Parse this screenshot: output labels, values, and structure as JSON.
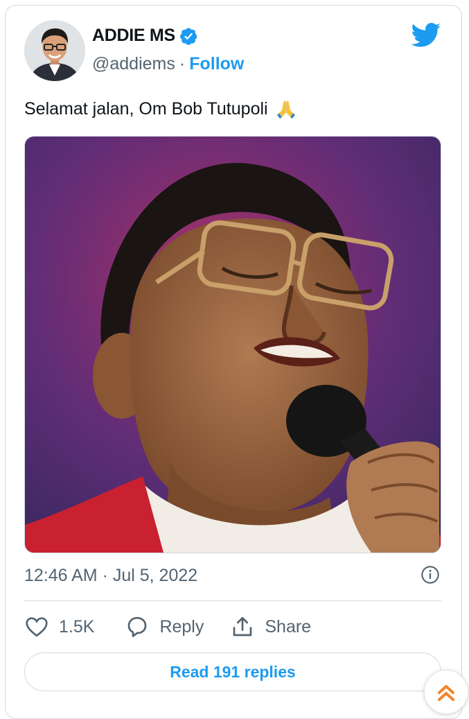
{
  "author": {
    "display_name": "ADDIE MS",
    "handle": "@addiems",
    "separator": "·",
    "follow_label": "Follow"
  },
  "tweet": {
    "text": "Selamat jalan, Om Bob Tutupoli",
    "emoji": "folded-hands-emoji",
    "timestamp": "12:46 AM · Jul 5, 2022"
  },
  "actions": {
    "like_count": "1.5K",
    "reply_label": "Reply",
    "share_label": "Share"
  },
  "read_replies_label": "Read 191 replies",
  "icons": {
    "verified": "verified-badge-icon",
    "brand": "twitter-bird-icon",
    "info": "info-icon",
    "like": "heart-icon",
    "reply": "speech-bubble-icon",
    "share": "share-upload-icon",
    "scroll": "chevron-double-up-icon"
  },
  "colors": {
    "accent": "#1d9bf0",
    "secondary_text": "#536471",
    "border": "#cfd9de",
    "scroll_arrow": "#f0862b"
  }
}
